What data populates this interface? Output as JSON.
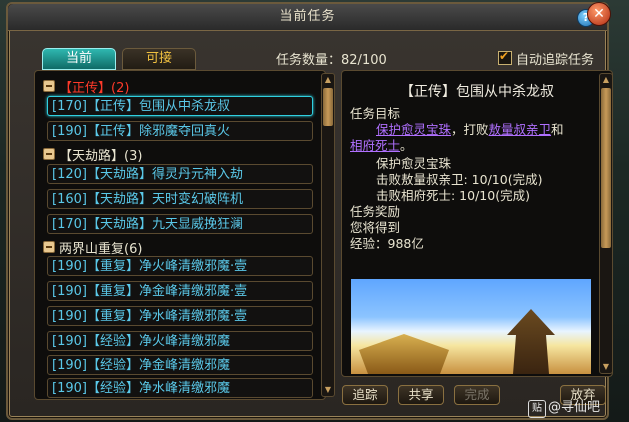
{
  "window": {
    "title": "当前任务"
  },
  "tabs": [
    {
      "label": "当前"
    },
    {
      "label": "可接"
    }
  ],
  "header": {
    "quest_count_label": "任务数量：",
    "quest_count_value": "82/100",
    "auto_track_label": "自动追踪任务",
    "auto_track_checked": true
  },
  "groups": [
    {
      "title": "【正传】(2)",
      "color": "#ff3a2a"
    },
    {
      "title": "【天劫路】(3)",
      "color": "#e8e4d0"
    },
    {
      "title": "两界山重复(6)",
      "color": "#e8e4d0"
    }
  ],
  "quests": [
    {
      "label": "[170]【正传】包围从中杀龙叔",
      "selected": true
    },
    {
      "label": "[190]【正传】除邪魔夺回真火"
    },
    {
      "label": "[120]【天劫路】得灵丹元神入劫"
    },
    {
      "label": "[160]【天劫路】天时变幻破阵机"
    },
    {
      "label": "[170]【天劫路】九天显威挽狂澜"
    },
    {
      "label": "[190]【重复】净火峰清缴邪魔·壹"
    },
    {
      "label": "[190]【重复】净金峰清缴邪魔·壹"
    },
    {
      "label": "[190]【重复】净水峰清缴邪魔·壹"
    },
    {
      "label": "[190]【经验】净火峰清缴邪魔"
    },
    {
      "label": "[190]【经验】净金峰清缴邪魔"
    },
    {
      "label": "[190]【经验】净水峰清缴邪魔"
    }
  ],
  "detail": {
    "title": "【正传】包围从中杀龙叔",
    "objective_heading": "任务目标",
    "objective_link1": "保护愈灵宝珠",
    "objective_sep1": "，打败",
    "objective_link2": "敖量叔亲卫",
    "objective_and": "和",
    "objective_link3": "相府死士",
    "objective_end": "。",
    "progress": [
      "保护愈灵宝珠",
      "击败敖量叔亲卫: 10/10(完成)",
      "击败相府死士: 10/10(完成)"
    ],
    "reward_heading": "任务奖励",
    "reward_intro": "您将得到",
    "reward_exp": "经验：988亿"
  },
  "buttons": {
    "track": "追踪",
    "share": "共享",
    "complete": "完成",
    "abandon": "放弃"
  },
  "icons": {
    "help": "?",
    "close": "✕"
  },
  "watermark": "@寻仙吧",
  "watermark_logo": "贴"
}
